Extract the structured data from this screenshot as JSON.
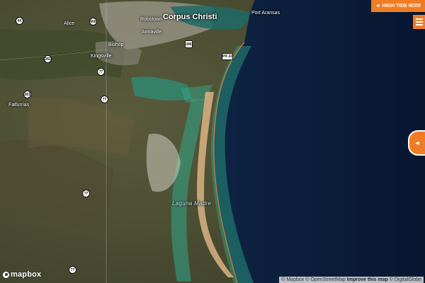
{
  "map": {
    "places": [
      {
        "id": "corpus-christi",
        "name": "Corpus Christi",
        "kind": "city"
      },
      {
        "id": "port-aransas",
        "name": "Port Aransas",
        "kind": "town"
      },
      {
        "id": "alice",
        "name": "Alice",
        "kind": "town"
      },
      {
        "id": "kingsville",
        "name": "Kingsville",
        "kind": "town"
      },
      {
        "id": "bishop",
        "name": "Bishop",
        "kind": "town"
      },
      {
        "id": "falfurrias",
        "name": "Falfurrias",
        "kind": "town"
      },
      {
        "id": "robstown",
        "name": "Robstown",
        "kind": "town"
      },
      {
        "id": "annaville",
        "name": "Annaville",
        "kind": "town"
      },
      {
        "id": "laguna-madre",
        "name": "Laguna Madre",
        "kind": "water"
      }
    ],
    "shields": [
      {
        "id": "44",
        "label": "44",
        "kind": "us"
      },
      {
        "id": "666",
        "label": "666",
        "kind": "us"
      },
      {
        "id": "281a",
        "label": "281",
        "kind": "us"
      },
      {
        "id": "286",
        "label": "286",
        "kind": "state"
      },
      {
        "id": "77a",
        "label": "77",
        "kind": "us"
      },
      {
        "id": "281b",
        "label": "281",
        "kind": "us"
      },
      {
        "id": "77b",
        "label": "77",
        "kind": "us"
      },
      {
        "id": "77c",
        "label": "77",
        "kind": "us"
      },
      {
        "id": "77d",
        "label": "77",
        "kind": "us"
      },
      {
        "id": "pr22",
        "label": "PR 22",
        "kind": "fm"
      }
    ]
  },
  "controls": {
    "high_tide_arrow": "◄",
    "high_tide_label": "HIGH TIDE NOW",
    "side_tab_arrow": "◄",
    "menu_icon": "hamburger-menu-icon"
  },
  "branding": {
    "logo_text": "mapbox"
  },
  "attribution": {
    "mapbox": "© Mapbox",
    "osm": "© OpenStreetMap",
    "improve": "Improve this map",
    "digitalglobe": "© DigitalGlobe"
  },
  "colors": {
    "accent": "#f07d23",
    "ocean": "#0b1a33",
    "overlay": "#2fa88a"
  }
}
